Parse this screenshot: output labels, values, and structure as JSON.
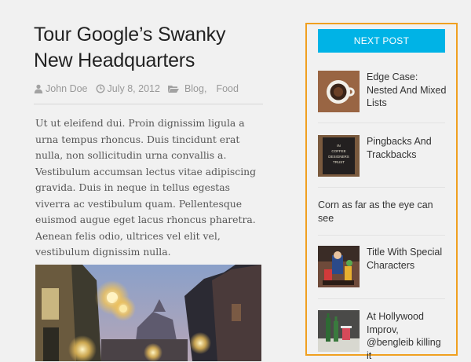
{
  "article": {
    "title": "Tour Google’s Swanky New Headquarters",
    "author": "John Doe",
    "date": "July 8, 2012",
    "categories": [
      "Blog,",
      "Food"
    ],
    "body": "Ut ut eleifend dui. Proin dignissim ligula a urna tempus rhoncus. Duis tincidunt erat nulla, non sollicitudin urna convallis a. Vestibulum accumsan lectus vitae adipiscing gravida. Duis in neque in tellus egestas viverra ac vestibulum quam. Pellentesque euismod augue eget lacus rhoncus pharetra. Aenean felis odio, ultrices vel elit vel, vestibulum dignissim nulla.",
    "icons": {
      "author": "user-icon",
      "date": "clock-icon",
      "categories": "folder-icon"
    }
  },
  "sidebar": {
    "heading": "NEXT POST",
    "posts": [
      {
        "title": "Edge Case: Nested And Mixed Lists",
        "thumb": "coffee-cup-thumbnail"
      },
      {
        "title": "Pingbacks And Trackbacks",
        "thumb": "coffee-sign-thumbnail",
        "thumb_text": "IN COFFEE DESIGNERS TRUST"
      },
      {
        "title": "Corn as far as the eye can see"
      },
      {
        "title": "Title With Special Characters",
        "thumb": "desk-toys-thumbnail"
      },
      {
        "title": "At Hollywood Improv, @bengleib killing it",
        "thumb": "bottles-thumbnail"
      }
    ]
  },
  "colors": {
    "accent": "#00b3e6",
    "sidebar_border": "#f0a020",
    "background": "#f1f1f1"
  }
}
